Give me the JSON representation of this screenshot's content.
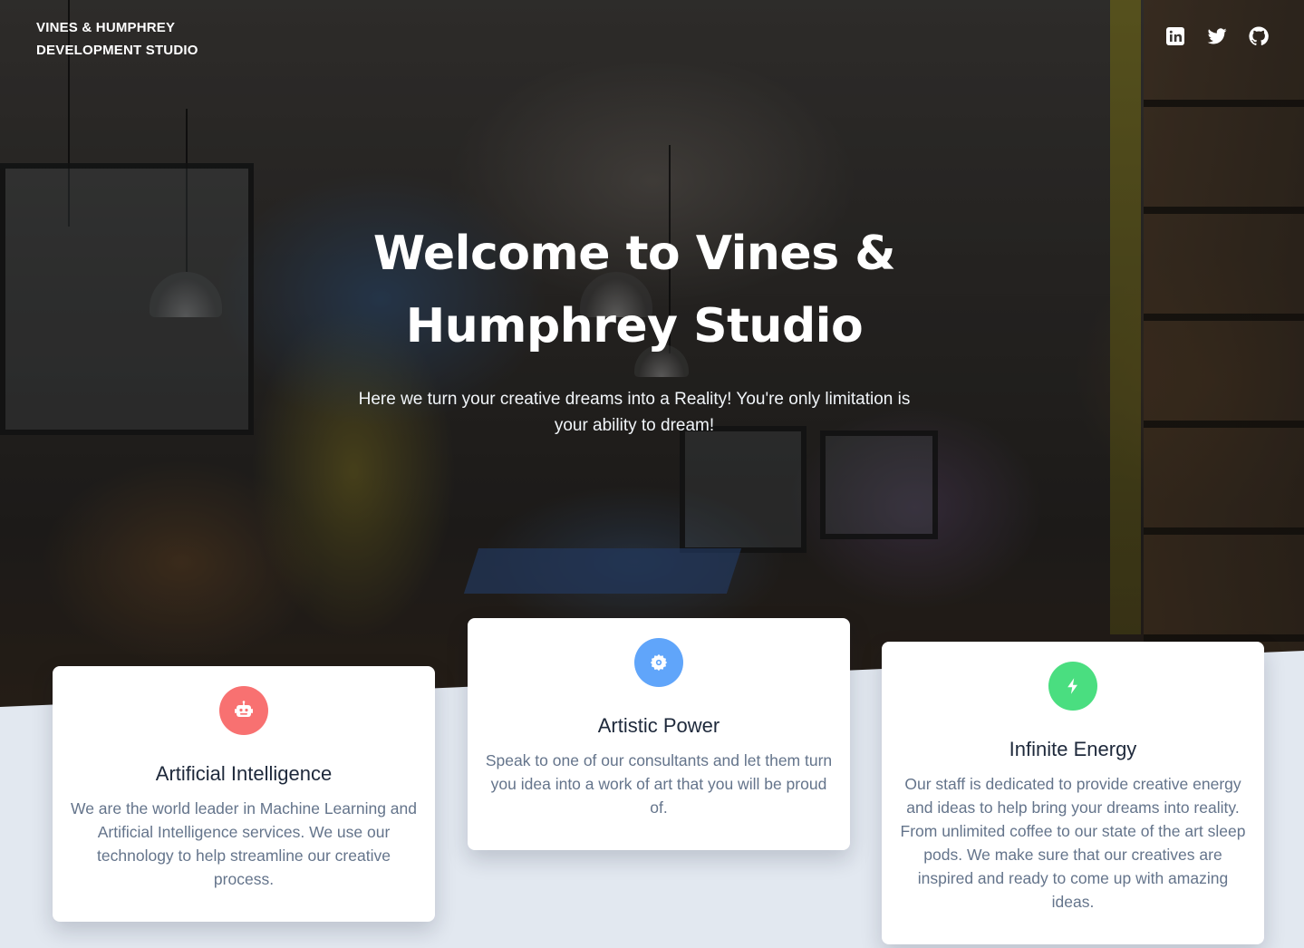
{
  "brand": {
    "line1": "VINES & HUMPHREY",
    "line2": "DEVELOPMENT STUDIO"
  },
  "social": [
    {
      "name": "linkedin-icon",
      "color": "#ffffff"
    },
    {
      "name": "twitter-icon",
      "color": "#ffffff"
    },
    {
      "name": "github-icon",
      "color": "#ffffff"
    }
  ],
  "hero": {
    "title_line1": "Welcome to Vines &",
    "title_line2": "Humphrey Studio",
    "subtitle": "Here we turn your creative dreams into a Reality! You're only limitation is your ability to dream!"
  },
  "features": [
    {
      "title": "Artificial Intelligence",
      "text": "We are the world leader in Machine Learning and Artificial Intelligence services. We use our technology to help streamline our creative process.",
      "icon": "robot-icon",
      "color": "#f87171"
    },
    {
      "title": "Artistic Power",
      "text": "Speak to one of our consultants and let them turn you idea into a work of art that you will be proud of.",
      "icon": "cog-icon",
      "color": "#60a5fa"
    },
    {
      "title": "Infinite Energy",
      "text": "Our staff is dedicated to provide creative energy and ideas to help bring your dreams into reality. From unlimited coffee to our state of the art sleep pods. We make sure that our creatives are inspired and ready to come up with amazing ideas.",
      "icon": "lightning-icon",
      "color": "#4ade80"
    }
  ]
}
